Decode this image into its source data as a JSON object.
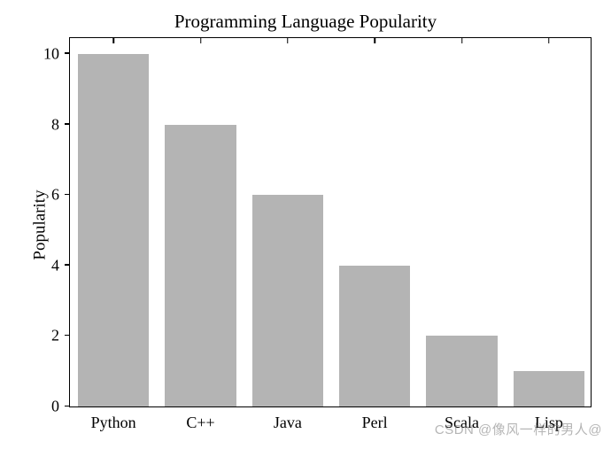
{
  "chart_data": {
    "type": "bar",
    "title": "Programming Language Popularity",
    "xlabel": "",
    "ylabel": "Popularity",
    "categories": [
      "Python",
      "C++",
      "Java",
      "Perl",
      "Scala",
      "Lisp"
    ],
    "values": [
      10,
      8,
      6,
      4,
      2,
      1
    ],
    "ylim": [
      0,
      10.5
    ],
    "yticks": [
      0,
      2,
      4,
      6,
      8,
      10
    ],
    "bar_color": "#b4b4b4"
  },
  "watermark": "CSDN @像风一样的男人@"
}
